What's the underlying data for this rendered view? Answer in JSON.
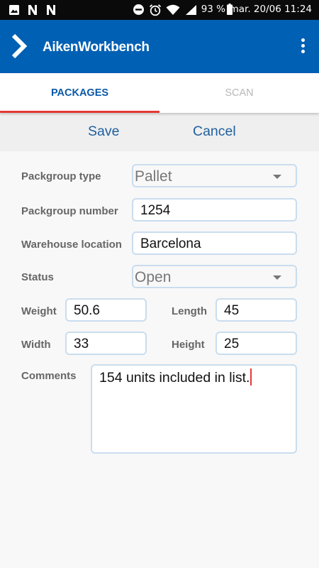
{
  "status_bar": {
    "icons_left": [
      "image-icon",
      "n-icon",
      "n-icon"
    ],
    "icons_right": [
      "do-not-disturb-icon",
      "alarm-icon",
      "wifi-icon",
      "signal-icon",
      "battery-icon"
    ],
    "battery": "93 %",
    "datetime": "mar. 20/06 11:24"
  },
  "app_bar": {
    "title": "AikenWorkbench",
    "color": "#0060b4"
  },
  "tabs": [
    {
      "label": "PACKAGES",
      "active": true
    },
    {
      "label": "SCAN",
      "active": false
    }
  ],
  "actions": {
    "save": "Save",
    "cancel": "Cancel"
  },
  "form": {
    "packgroup_type": {
      "label": "Packgroup type",
      "value": "Pallet"
    },
    "packgroup_number": {
      "label": "Packgroup number",
      "value": "1254"
    },
    "warehouse_location": {
      "label": "Warehouse location",
      "value": "Barcelona"
    },
    "status": {
      "label": "Status",
      "value": "Open"
    },
    "weight": {
      "label": "Weight",
      "value": "50.6"
    },
    "length": {
      "label": "Length",
      "value": "45"
    },
    "width": {
      "label": "Width",
      "value": "33"
    },
    "height": {
      "label": "Height",
      "value": "25"
    },
    "comments": {
      "label": "Comments",
      "value": "154 units included in list."
    }
  },
  "colors": {
    "accent": "#e53935",
    "tab_active": "#0b5aa6",
    "field_border": "#c9ddef"
  }
}
